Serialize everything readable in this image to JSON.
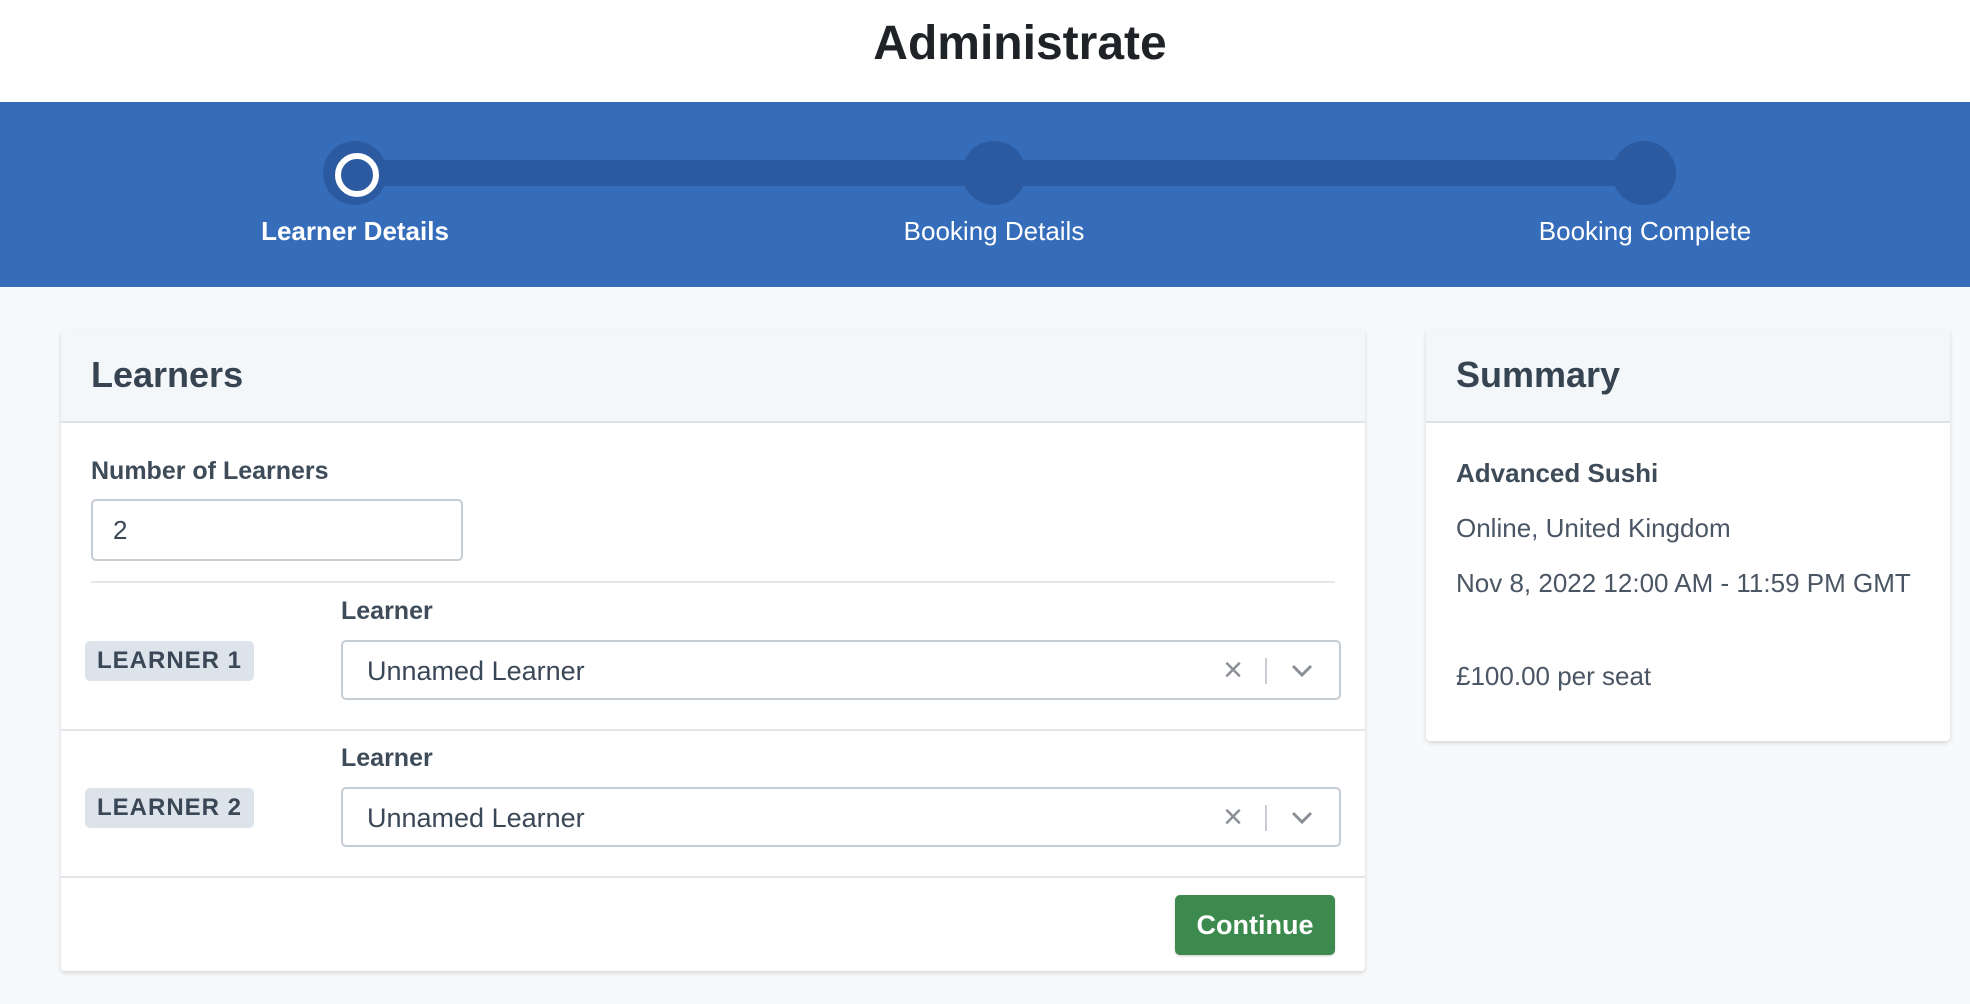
{
  "app": {
    "title": "Administrate"
  },
  "stepper": {
    "steps": [
      {
        "label": "Learner Details",
        "active": true
      },
      {
        "label": "Booking Details",
        "active": false
      },
      {
        "label": "Booking Complete",
        "active": false
      }
    ]
  },
  "learners_card": {
    "title": "Learners",
    "number_label": "Number of Learners",
    "number_value": "2",
    "learners": [
      {
        "badge": "LEARNER 1",
        "field_label": "Learner",
        "selected": "Unnamed Learner"
      },
      {
        "badge": "LEARNER 2",
        "field_label": "Learner",
        "selected": "Unnamed Learner"
      }
    ],
    "continue_label": "Continue"
  },
  "summary_card": {
    "title": "Summary",
    "course": "Advanced Sushi",
    "location": "Online, United Kingdom",
    "date": "Nov 8, 2022 12:00 AM - 11:59 PM GMT",
    "price": "£100.00 per seat"
  },
  "icons": {
    "clear": "close-icon",
    "dropdown": "chevron-down-icon",
    "step": "circle-icon"
  },
  "colors": {
    "brand_blue": "#356dbb",
    "track_blue": "#2c5aa0",
    "continue_green": "#3d8a4f"
  }
}
